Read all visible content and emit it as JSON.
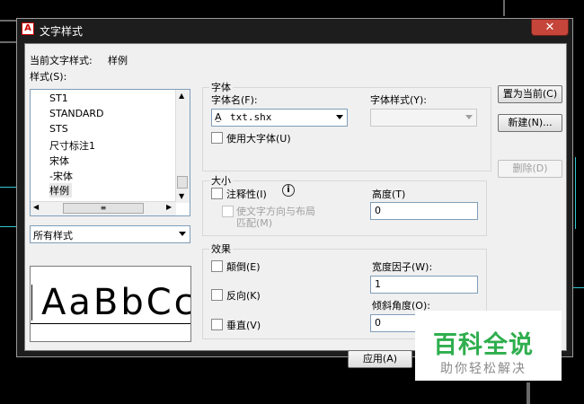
{
  "window": {
    "title": "文字样式",
    "close_symbol": "✕"
  },
  "current_style": {
    "label": "当前文字样式:",
    "value": "样例"
  },
  "styles": {
    "label": "样式(S):",
    "items": [
      "ST1",
      "STANDARD",
      "STS",
      "尺寸标注1",
      "宋体",
      "-宋体",
      "样例"
    ],
    "selected": "样例"
  },
  "filter": {
    "value": "所有样式"
  },
  "preview": {
    "text": "AaBbCc"
  },
  "font": {
    "group_label": "字体",
    "name_label": "字体名(F):",
    "name_value": "txt.shx",
    "style_label": "字体样式(Y):",
    "style_value": "",
    "bigfont_label": "使用大字体(U)"
  },
  "size": {
    "group_label": "大小",
    "annotative_label": "注释性(I)",
    "match_orientation_line1": "使文字方向与布局",
    "match_orientation_line2": "匹配(M)",
    "height_label": "高度(T)",
    "height_value": "0"
  },
  "effects": {
    "group_label": "效果",
    "upside_down_label": "颠倒(E)",
    "backwards_label": "反向(K)",
    "vertical_label": "垂直(V)",
    "width_factor_label": "宽度因子(W):",
    "width_factor_value": "1",
    "oblique_label": "倾斜角度(O):",
    "oblique_value": "0"
  },
  "buttons": {
    "set_current": "置为当前(C)",
    "new": "新建(N)...",
    "delete": "删除(D)",
    "apply": "应用(A)"
  },
  "watermark": {
    "title": "百科全说",
    "subtitle": "助你轻松解决"
  },
  "colors": {
    "accent": "#33c8d0",
    "watermark_green": "#2fae4e",
    "close_red": "#c6453a"
  }
}
